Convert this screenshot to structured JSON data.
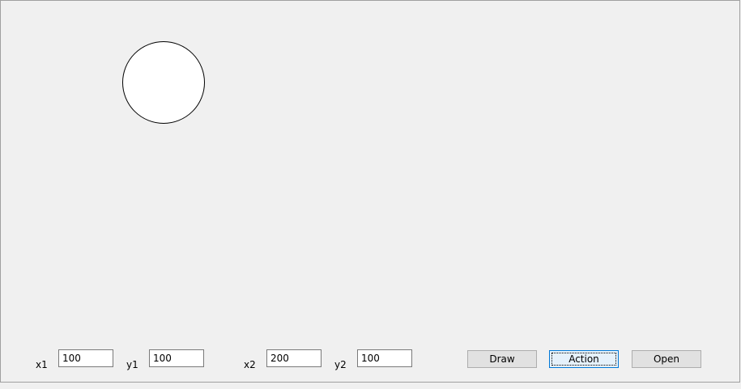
{
  "form": {
    "fields": {
      "x1": {
        "label": "x1",
        "value": "100"
      },
      "y1": {
        "label": "y1",
        "value": "100"
      },
      "x2": {
        "label": "x2",
        "value": "200"
      },
      "y2": {
        "label": "y2",
        "value": "100"
      }
    },
    "buttons": {
      "draw": "Draw",
      "action": "Action",
      "open": "Open"
    }
  }
}
